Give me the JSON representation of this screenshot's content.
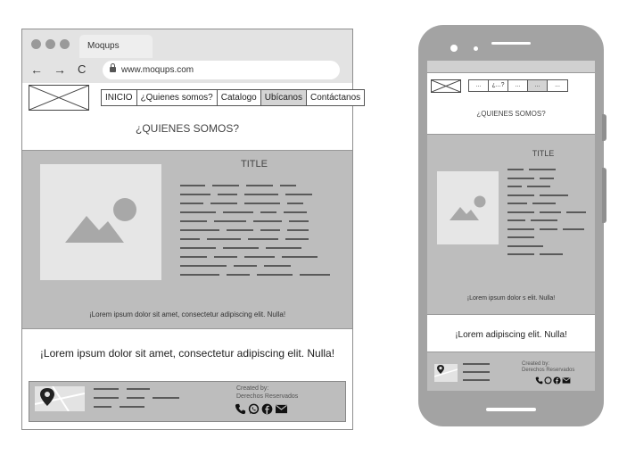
{
  "desktop": {
    "browser": {
      "tab_title": "Moqups",
      "back_glyph": "←",
      "forward_glyph": "→",
      "reload_glyph": "C",
      "url": "www.moqups.com",
      "lock_icon": "lock-icon"
    },
    "nav": {
      "items": [
        {
          "label": "INICIO"
        },
        {
          "label": "¿Quienes somos?"
        },
        {
          "label": "Catalogo"
        },
        {
          "label": "Ubícanos"
        },
        {
          "label": "Contáctanos"
        }
      ],
      "active_index": 3
    },
    "section_heading": "¿QUIENES SOMOS?",
    "hero": {
      "title": "TITLE",
      "caption": "¡Lorem ipsum dolor sit amet, consectetur adipiscing elit. Nulla!"
    },
    "tagline": "¡Lorem ipsum dolor sit amet, consectetur adipiscing elit. Nulla!",
    "footer": {
      "credit_line1": "Created by:",
      "credit_line2": "Derechos Reservados",
      "social_icons": [
        "phone-icon",
        "whatsapp-icon",
        "facebook-icon",
        "mail-icon"
      ]
    }
  },
  "mobile": {
    "nav": {
      "items": [
        {
          "label": "..."
        },
        {
          "label": "¿...?"
        },
        {
          "label": "..."
        },
        {
          "label": "..."
        },
        {
          "label": "..."
        }
      ],
      "active_index": 3
    },
    "section_heading": "¿QUIENES SOMOS?",
    "hero": {
      "title": "TITLE",
      "caption": "¡Lorem ipsum dolor s elit. Nulla!"
    },
    "tagline": "¡Lorem adipiscing elit. Nulla!",
    "footer": {
      "credit_line1": "Created by:",
      "credit_line2": "Derechos Reservados",
      "social_icons": [
        "phone-icon",
        "whatsapp-icon",
        "facebook-icon",
        "mail-icon"
      ]
    }
  },
  "colors": {
    "section_gray": "#bdbdbd",
    "placeholder_gray": "#e6e6e6",
    "device_gray": "#a3a3a3",
    "active_menu": "#d4d4d4"
  }
}
